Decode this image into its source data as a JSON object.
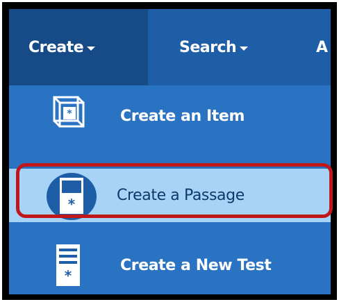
{
  "navbar": {
    "tabs": [
      {
        "label": "Create",
        "active": true
      },
      {
        "label": "Search",
        "active": false
      },
      {
        "label": "A",
        "active": false
      }
    ]
  },
  "menu": {
    "items": [
      {
        "label": "Create an Item",
        "icon": "cube-item-icon"
      },
      {
        "label": "Create a Passage",
        "icon": "passage-document-icon",
        "highlighted": true
      },
      {
        "label": "Create a New Test",
        "icon": "test-document-icon"
      }
    ]
  },
  "colors": {
    "nav_background": "#1e5ea6",
    "nav_active": "#174b88",
    "menu_background": "#2a73c2",
    "highlight_background": "#a7d3f6",
    "annotation_ring": "#c0171a"
  }
}
